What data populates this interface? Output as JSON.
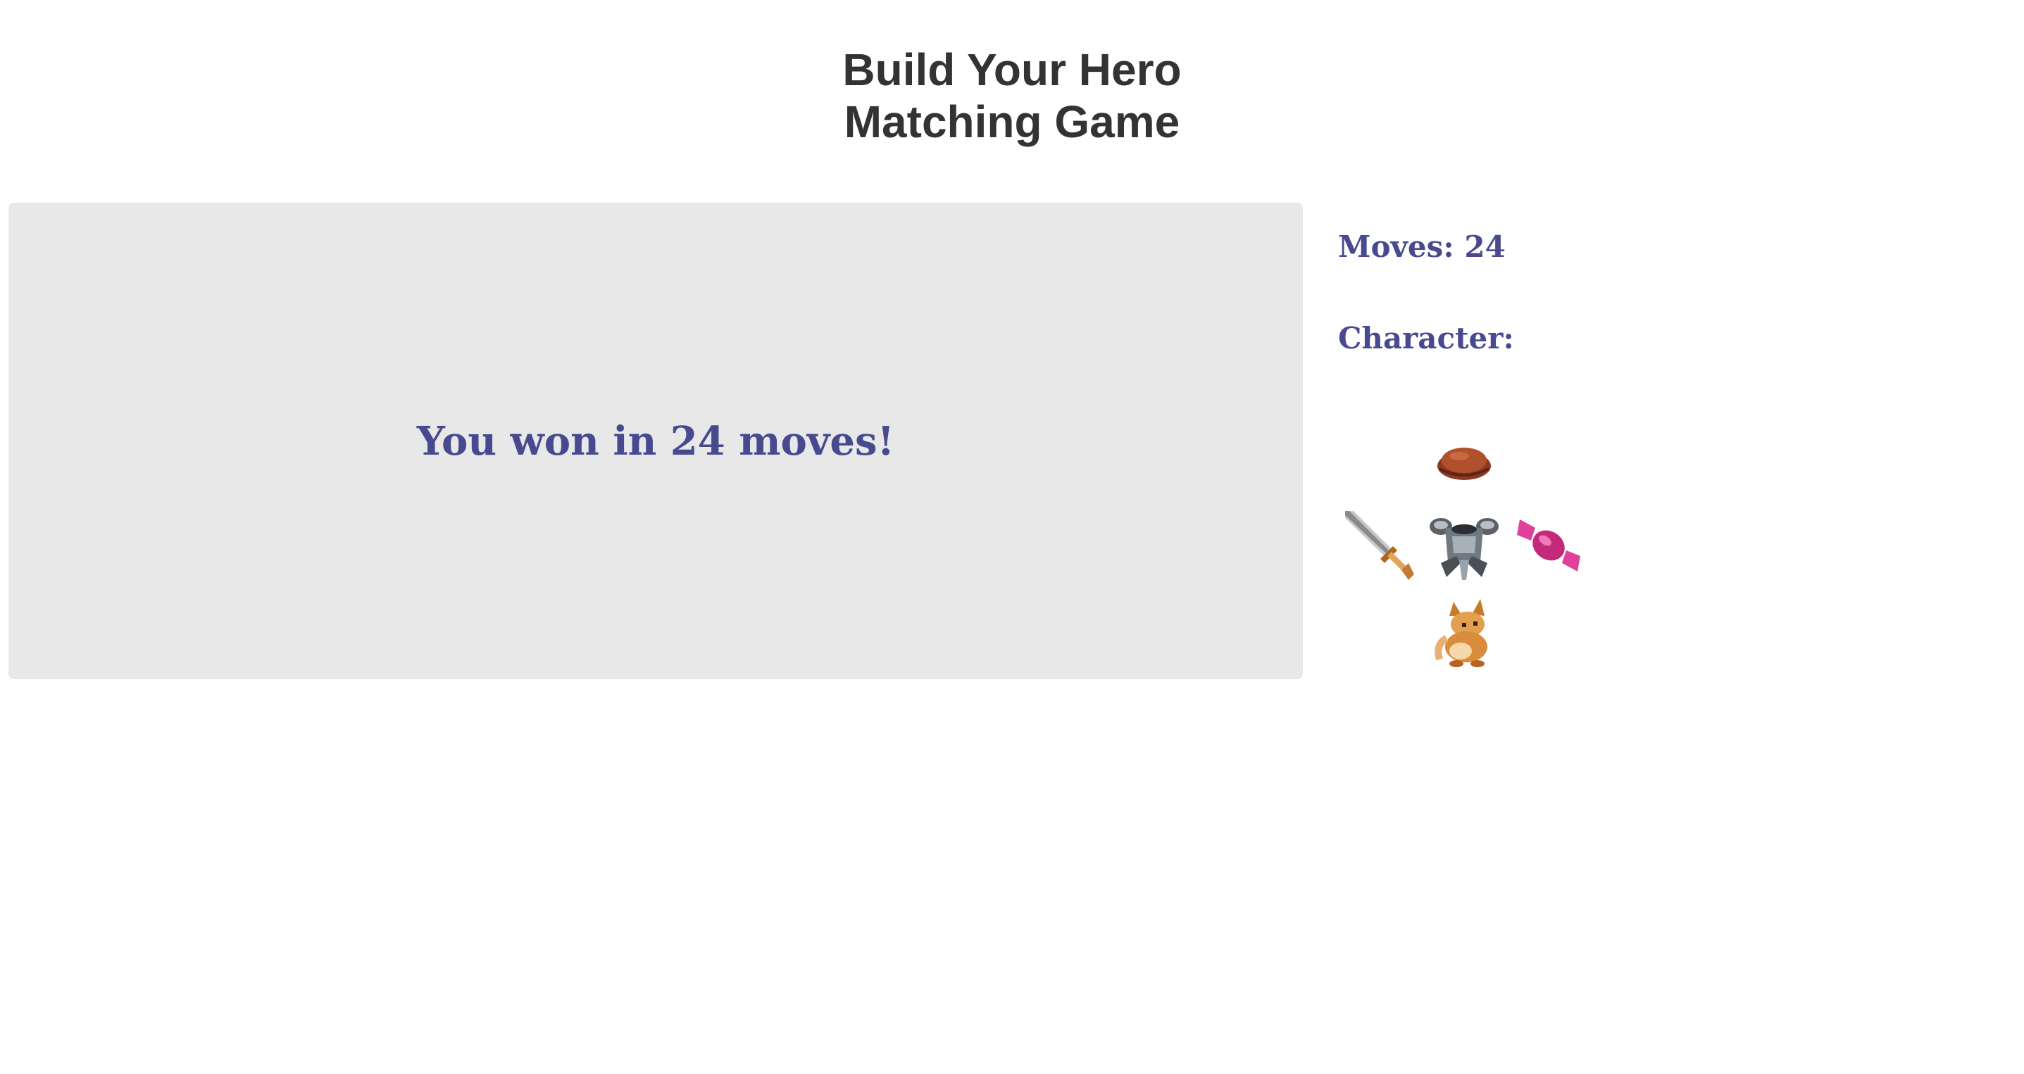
{
  "header": {
    "title_line1": "Build Your Hero",
    "title_line2": "Matching Game"
  },
  "board": {
    "win_message": "You won in 24 moves!"
  },
  "sidebar": {
    "moves_label": "Moves: 24",
    "moves": 24,
    "character_label": "Character:"
  },
  "character": {
    "head_icon": "leather-cap-icon",
    "weapon_icon": "sword-icon",
    "body_icon": "steel-armor-icon",
    "item_icon": "candy-icon",
    "feet_icon": "fox-pet-icon"
  },
  "colors": {
    "text_accent": "#474a8f",
    "title": "#333333",
    "board_bg": "#e8e8e9"
  }
}
